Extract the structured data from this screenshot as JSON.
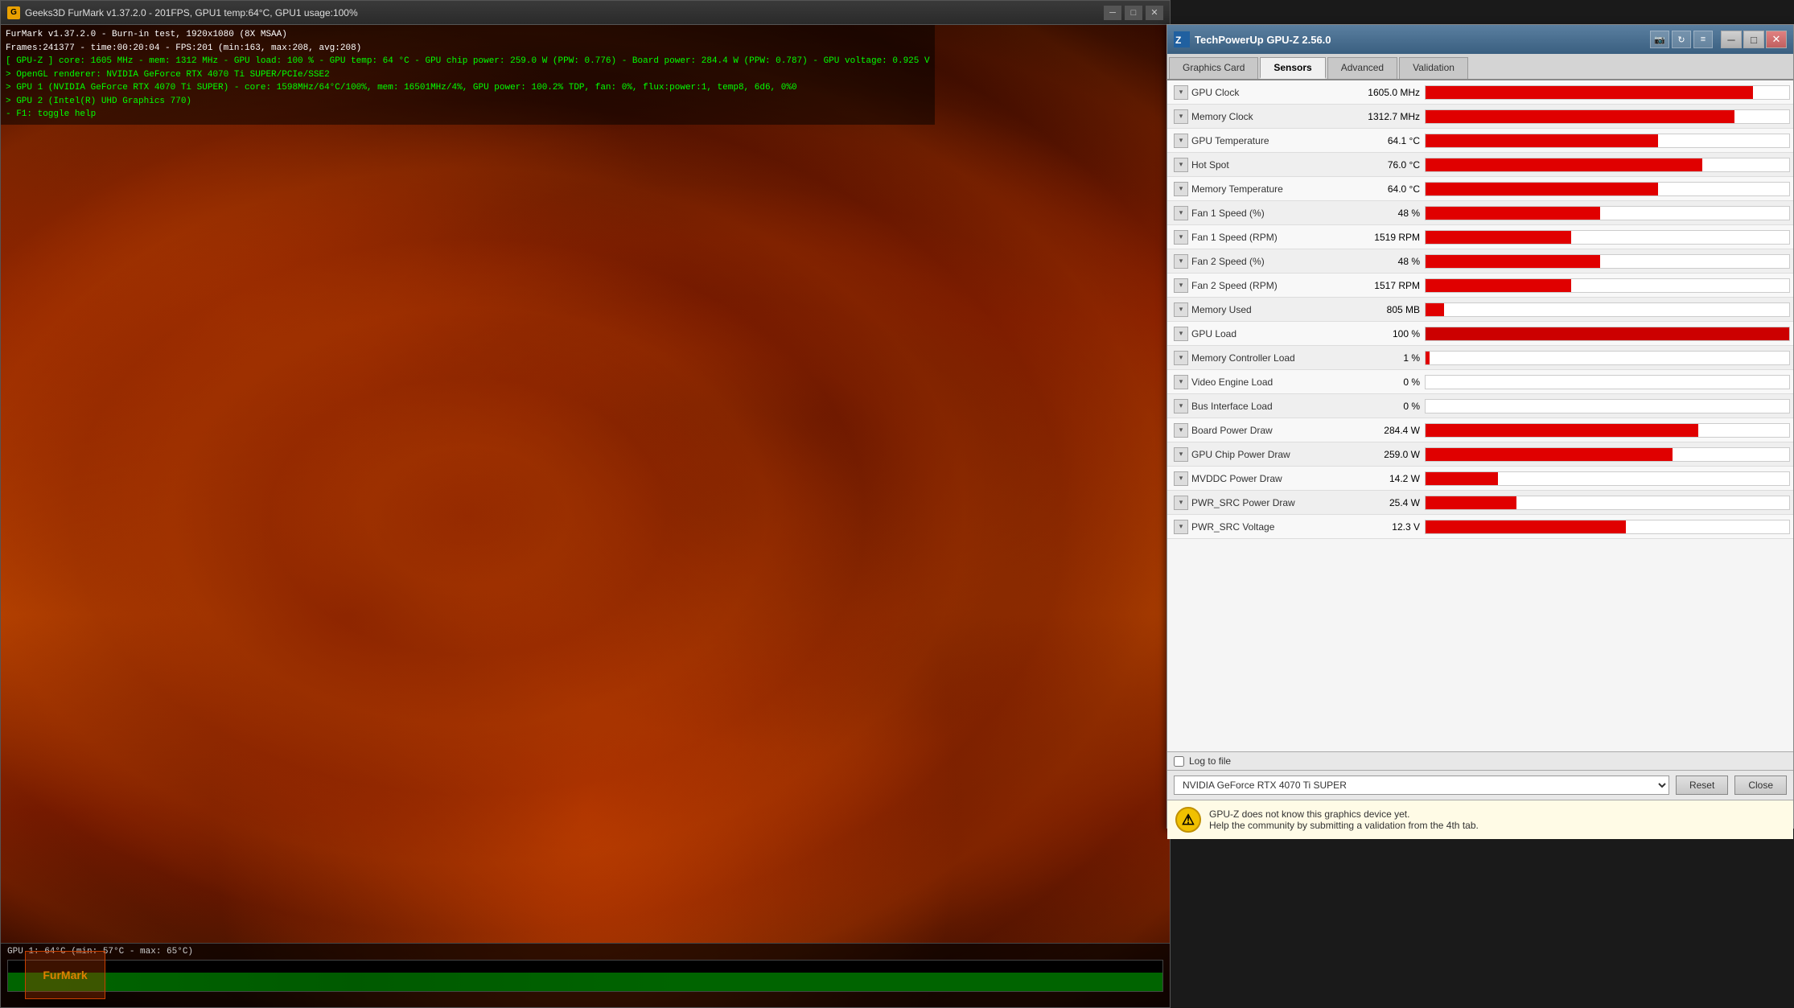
{
  "furmark": {
    "title": "Geeks3D FurMark v1.37.2.0 - 201FPS, GPU1 temp:64°C, GPU1 usage:100%",
    "overlay": {
      "line1": "FurMark v1.37.2.0 - Burn-in test, 1920x1080 (8X MSAA)",
      "line2": "Frames:241377 - time:00:20:04 - FPS:201 (min:163, max:208, avg:208)",
      "line3": "[ GPU-Z ] core: 1605 MHz - mem: 1312 MHz - GPU load: 100 % - GPU temp: 64 °C - GPU chip power: 259.0 W (PPW: 0.776) - Board power: 284.4 W (PPW: 0.787) - GPU voltage: 0.925 V",
      "line4": "> OpenGL renderer: NVIDIA GeForce RTX 4070 Ti SUPER/PCIe/SSE2",
      "line5": "> GPU 1 (NVIDIA GeForce RTX 4070 Ti SUPER) - core: 1598MHz/64°C/100%, mem: 16501MHz/4%, GPU power: 100.2% TDP, fan: 0%, flux:power:1, temp8, 6d6, 0%0",
      "line6": "> GPU 2 (Intel(R) UHD Graphics 770)",
      "line7": "- F1: toggle help"
    },
    "gpu_temp_label": "GPU 1: 64°C (min: 57°C - max: 65°C)"
  },
  "gpuz": {
    "title": "TechPowerUp GPU-Z 2.56.0",
    "tabs": [
      {
        "label": "Graphics Card",
        "active": false
      },
      {
        "label": "Sensors",
        "active": true
      },
      {
        "label": "Advanced",
        "active": false
      },
      {
        "label": "Validation",
        "active": false
      }
    ],
    "sensors": [
      {
        "name": "GPU Clock",
        "value": "1605.0 MHz",
        "bar_pct": 90,
        "has_bar": true
      },
      {
        "name": "Memory Clock",
        "value": "1312.7 MHz",
        "bar_pct": 85,
        "has_bar": true
      },
      {
        "name": "GPU Temperature",
        "value": "64.1 °C",
        "bar_pct": 64,
        "has_bar": true
      },
      {
        "name": "Hot Spot",
        "value": "76.0 °C",
        "bar_pct": 76,
        "has_bar": true
      },
      {
        "name": "Memory Temperature",
        "value": "64.0 °C",
        "bar_pct": 64,
        "has_bar": true
      },
      {
        "name": "Fan 1 Speed (%)",
        "value": "48 %",
        "bar_pct": 48,
        "has_bar": true
      },
      {
        "name": "Fan 1 Speed (RPM)",
        "value": "1519 RPM",
        "bar_pct": 40,
        "has_bar": true
      },
      {
        "name": "Fan 2 Speed (%)",
        "value": "48 %",
        "bar_pct": 48,
        "has_bar": true
      },
      {
        "name": "Fan 2 Speed (RPM)",
        "value": "1517 RPM",
        "bar_pct": 40,
        "has_bar": true
      },
      {
        "name": "Memory Used",
        "value": "805 MB",
        "bar_pct": 5,
        "has_bar": true
      },
      {
        "name": "GPU Load",
        "value": "100 %",
        "bar_pct": 100,
        "has_bar": true
      },
      {
        "name": "Memory Controller Load",
        "value": "1 %",
        "bar_pct": 1,
        "has_bar": true
      },
      {
        "name": "Video Engine Load",
        "value": "0 %",
        "bar_pct": 0,
        "has_bar": true
      },
      {
        "name": "Bus Interface Load",
        "value": "0 %",
        "bar_pct": 0,
        "has_bar": true
      },
      {
        "name": "Board Power Draw",
        "value": "284.4 W",
        "bar_pct": 75,
        "has_bar": true
      },
      {
        "name": "GPU Chip Power Draw",
        "value": "259.0 W",
        "bar_pct": 68,
        "has_bar": true
      },
      {
        "name": "MVDDC Power Draw",
        "value": "14.2 W",
        "bar_pct": 20,
        "has_bar": true
      },
      {
        "name": "PWR_SRC Power Draw",
        "value": "25.4 W",
        "bar_pct": 25,
        "has_bar": true
      },
      {
        "name": "PWR_SRC Voltage",
        "value": "12.3 V",
        "bar_pct": 55,
        "has_bar": true
      }
    ],
    "gpu_selector": "NVIDIA GeForce RTX 4070 Ti SUPER",
    "buttons": {
      "reset": "Reset",
      "close": "Close"
    },
    "log_to_file": "Log to file",
    "notification": {
      "text1": "GPU-Z does not know this graphics device yet.",
      "text2": "Help the community by submitting a validation from the 4th tab."
    }
  }
}
